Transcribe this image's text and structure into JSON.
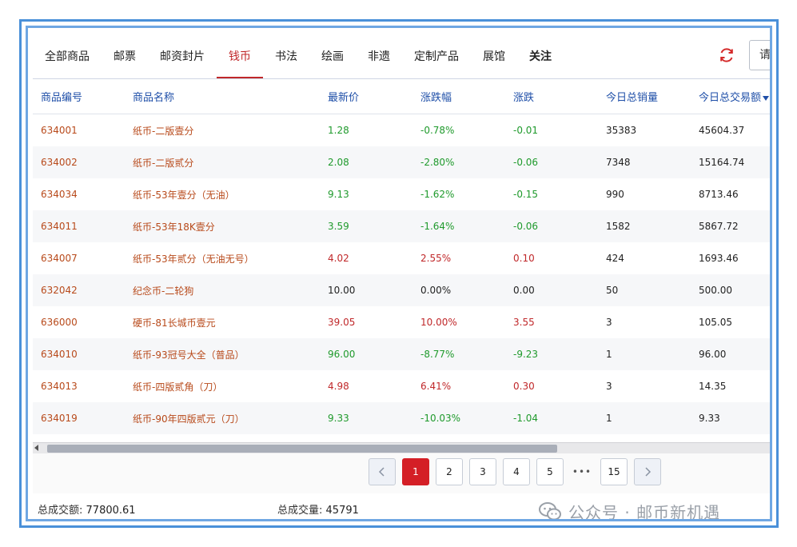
{
  "tabs": [
    {
      "label": "全部商品",
      "active": false
    },
    {
      "label": "邮票",
      "active": false
    },
    {
      "label": "邮资封片",
      "active": false
    },
    {
      "label": "钱币",
      "active": true
    },
    {
      "label": "书法",
      "active": false
    },
    {
      "label": "绘画",
      "active": false
    },
    {
      "label": "非遗",
      "active": false
    },
    {
      "label": "定制产品",
      "active": false
    },
    {
      "label": "展馆",
      "active": false
    },
    {
      "label": "关注",
      "active": false
    }
  ],
  "toolbar": {
    "refresh_icon": "refresh-icon",
    "search_text": "请"
  },
  "table": {
    "headers": [
      "商品编号",
      "商品名称",
      "最新价",
      "涨跌幅",
      "涨跌",
      "今日总销量",
      "今日总交易额"
    ],
    "rows": [
      {
        "code": "634001",
        "name": "纸币-二版壹分",
        "price": "1.28",
        "pct": "-0.78%",
        "change": "-0.01",
        "volume": "35383",
        "amount": "45604.37",
        "trend": "down"
      },
      {
        "code": "634002",
        "name": "纸币-二版贰分",
        "price": "2.08",
        "pct": "-2.80%",
        "change": "-0.06",
        "volume": "7348",
        "amount": "15164.74",
        "trend": "down"
      },
      {
        "code": "634034",
        "name": "纸币-53年壹分（无油）",
        "price": "9.13",
        "pct": "-1.62%",
        "change": "-0.15",
        "volume": "990",
        "amount": "8713.46",
        "trend": "down"
      },
      {
        "code": "634011",
        "name": "纸币-53年18K壹分",
        "price": "3.59",
        "pct": "-1.64%",
        "change": "-0.06",
        "volume": "1582",
        "amount": "5867.72",
        "trend": "down"
      },
      {
        "code": "634007",
        "name": "纸币-53年贰分（无油无号）",
        "price": "4.02",
        "pct": "2.55%",
        "change": "0.10",
        "volume": "424",
        "amount": "1693.46",
        "trend": "up"
      },
      {
        "code": "632042",
        "name": "纪念币-二轮狗",
        "price": "10.00",
        "pct": "0.00%",
        "change": "0.00",
        "volume": "50",
        "amount": "500.00",
        "trend": "flat"
      },
      {
        "code": "636000",
        "name": "硬币-81长城币壹元",
        "price": "39.05",
        "pct": "10.00%",
        "change": "3.55",
        "volume": "3",
        "amount": "105.05",
        "trend": "up"
      },
      {
        "code": "634010",
        "name": "纸币-93冠号大全（普品）",
        "price": "96.00",
        "pct": "-8.77%",
        "change": "-9.23",
        "volume": "1",
        "amount": "96.00",
        "trend": "down"
      },
      {
        "code": "634013",
        "name": "纸币-四版贰角（刀）",
        "price": "4.98",
        "pct": "6.41%",
        "change": "0.30",
        "volume": "3",
        "amount": "14.35",
        "trend": "up"
      },
      {
        "code": "634019",
        "name": "纸币-90年四版贰元（刀）",
        "price": "9.33",
        "pct": "-10.03%",
        "change": "-1.04",
        "volume": "1",
        "amount": "9.33",
        "trend": "down"
      }
    ]
  },
  "pagination": {
    "pages": [
      "1",
      "2",
      "3",
      "4",
      "5"
    ],
    "ellipsis": "•••",
    "last": "15",
    "current": "1",
    "prev_icon": "chevron-left-icon",
    "next_icon": "chevron-right-icon"
  },
  "footer": {
    "total_amount_label": "总成交额:",
    "total_amount_value": "77800.61",
    "total_volume_label": "总成交量:",
    "total_volume_value": "45791"
  },
  "watermark": {
    "text": "公众号 · 邮币新机遇",
    "icon": "wechat-icon"
  },
  "colors": {
    "accent_red": "#c0282a",
    "down_green": "#1f9a2c",
    "header_blue": "#1f4fa8",
    "code_orange": "#b84a1b",
    "frame_blue": "#4a90d9"
  }
}
